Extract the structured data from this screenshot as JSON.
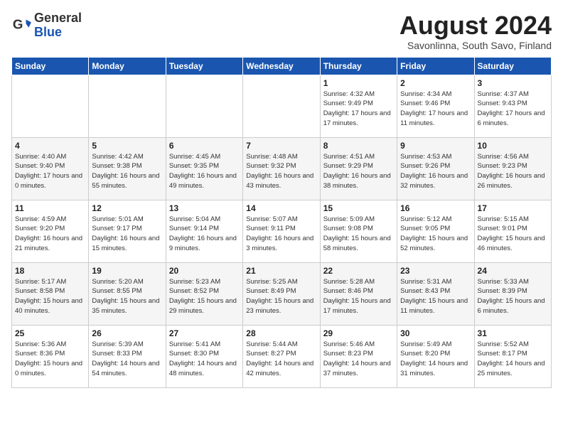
{
  "header": {
    "logo_general": "General",
    "logo_blue": "Blue",
    "month_title": "August 2024",
    "subtitle": "Savonlinna, South Savo, Finland"
  },
  "days_of_week": [
    "Sunday",
    "Monday",
    "Tuesday",
    "Wednesday",
    "Thursday",
    "Friday",
    "Saturday"
  ],
  "weeks": [
    [
      {
        "day": "",
        "info": ""
      },
      {
        "day": "",
        "info": ""
      },
      {
        "day": "",
        "info": ""
      },
      {
        "day": "",
        "info": ""
      },
      {
        "day": "1",
        "info": "Sunrise: 4:32 AM\nSunset: 9:49 PM\nDaylight: 17 hours\nand 17 minutes."
      },
      {
        "day": "2",
        "info": "Sunrise: 4:34 AM\nSunset: 9:46 PM\nDaylight: 17 hours\nand 11 minutes."
      },
      {
        "day": "3",
        "info": "Sunrise: 4:37 AM\nSunset: 9:43 PM\nDaylight: 17 hours\nand 6 minutes."
      }
    ],
    [
      {
        "day": "4",
        "info": "Sunrise: 4:40 AM\nSunset: 9:40 PM\nDaylight: 17 hours\nand 0 minutes."
      },
      {
        "day": "5",
        "info": "Sunrise: 4:42 AM\nSunset: 9:38 PM\nDaylight: 16 hours\nand 55 minutes."
      },
      {
        "day": "6",
        "info": "Sunrise: 4:45 AM\nSunset: 9:35 PM\nDaylight: 16 hours\nand 49 minutes."
      },
      {
        "day": "7",
        "info": "Sunrise: 4:48 AM\nSunset: 9:32 PM\nDaylight: 16 hours\nand 43 minutes."
      },
      {
        "day": "8",
        "info": "Sunrise: 4:51 AM\nSunset: 9:29 PM\nDaylight: 16 hours\nand 38 minutes."
      },
      {
        "day": "9",
        "info": "Sunrise: 4:53 AM\nSunset: 9:26 PM\nDaylight: 16 hours\nand 32 minutes."
      },
      {
        "day": "10",
        "info": "Sunrise: 4:56 AM\nSunset: 9:23 PM\nDaylight: 16 hours\nand 26 minutes."
      }
    ],
    [
      {
        "day": "11",
        "info": "Sunrise: 4:59 AM\nSunset: 9:20 PM\nDaylight: 16 hours\nand 21 minutes."
      },
      {
        "day": "12",
        "info": "Sunrise: 5:01 AM\nSunset: 9:17 PM\nDaylight: 16 hours\nand 15 minutes."
      },
      {
        "day": "13",
        "info": "Sunrise: 5:04 AM\nSunset: 9:14 PM\nDaylight: 16 hours\nand 9 minutes."
      },
      {
        "day": "14",
        "info": "Sunrise: 5:07 AM\nSunset: 9:11 PM\nDaylight: 16 hours\nand 3 minutes."
      },
      {
        "day": "15",
        "info": "Sunrise: 5:09 AM\nSunset: 9:08 PM\nDaylight: 15 hours\nand 58 minutes."
      },
      {
        "day": "16",
        "info": "Sunrise: 5:12 AM\nSunset: 9:05 PM\nDaylight: 15 hours\nand 52 minutes."
      },
      {
        "day": "17",
        "info": "Sunrise: 5:15 AM\nSunset: 9:01 PM\nDaylight: 15 hours\nand 46 minutes."
      }
    ],
    [
      {
        "day": "18",
        "info": "Sunrise: 5:17 AM\nSunset: 8:58 PM\nDaylight: 15 hours\nand 40 minutes."
      },
      {
        "day": "19",
        "info": "Sunrise: 5:20 AM\nSunset: 8:55 PM\nDaylight: 15 hours\nand 35 minutes."
      },
      {
        "day": "20",
        "info": "Sunrise: 5:23 AM\nSunset: 8:52 PM\nDaylight: 15 hours\nand 29 minutes."
      },
      {
        "day": "21",
        "info": "Sunrise: 5:25 AM\nSunset: 8:49 PM\nDaylight: 15 hours\nand 23 minutes."
      },
      {
        "day": "22",
        "info": "Sunrise: 5:28 AM\nSunset: 8:46 PM\nDaylight: 15 hours\nand 17 minutes."
      },
      {
        "day": "23",
        "info": "Sunrise: 5:31 AM\nSunset: 8:43 PM\nDaylight: 15 hours\nand 11 minutes."
      },
      {
        "day": "24",
        "info": "Sunrise: 5:33 AM\nSunset: 8:39 PM\nDaylight: 15 hours\nand 6 minutes."
      }
    ],
    [
      {
        "day": "25",
        "info": "Sunrise: 5:36 AM\nSunset: 8:36 PM\nDaylight: 15 hours\nand 0 minutes."
      },
      {
        "day": "26",
        "info": "Sunrise: 5:39 AM\nSunset: 8:33 PM\nDaylight: 14 hours\nand 54 minutes."
      },
      {
        "day": "27",
        "info": "Sunrise: 5:41 AM\nSunset: 8:30 PM\nDaylight: 14 hours\nand 48 minutes."
      },
      {
        "day": "28",
        "info": "Sunrise: 5:44 AM\nSunset: 8:27 PM\nDaylight: 14 hours\nand 42 minutes."
      },
      {
        "day": "29",
        "info": "Sunrise: 5:46 AM\nSunset: 8:23 PM\nDaylight: 14 hours\nand 37 minutes."
      },
      {
        "day": "30",
        "info": "Sunrise: 5:49 AM\nSunset: 8:20 PM\nDaylight: 14 hours\nand 31 minutes."
      },
      {
        "day": "31",
        "info": "Sunrise: 5:52 AM\nSunset: 8:17 PM\nDaylight: 14 hours\nand 25 minutes."
      }
    ]
  ]
}
